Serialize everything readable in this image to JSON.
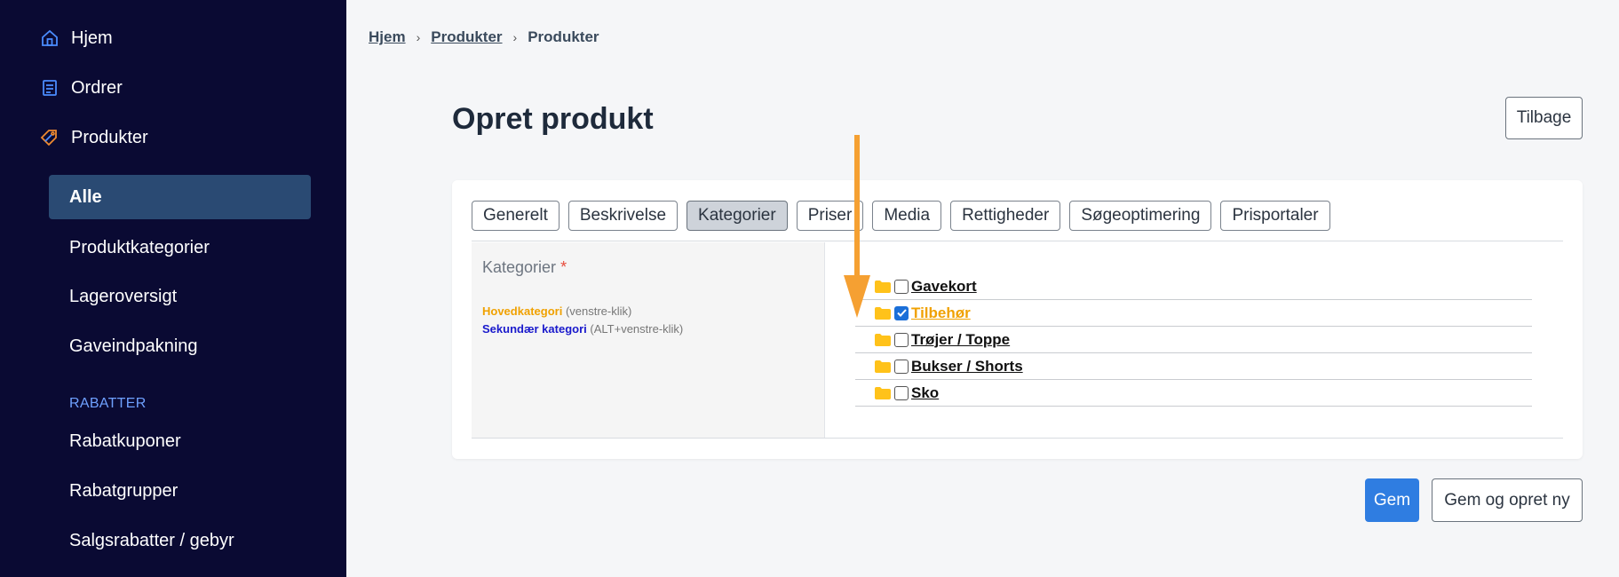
{
  "sidebar": {
    "nav": [
      {
        "label": "Hjem",
        "icon": "home-icon"
      },
      {
        "label": "Ordrer",
        "icon": "receipt-icon"
      },
      {
        "label": "Produkter",
        "icon": "tag-icon"
      }
    ],
    "sub": [
      {
        "label": "Alle",
        "active": true
      },
      {
        "label": "Produktkategorier"
      },
      {
        "label": "Lageroversigt"
      },
      {
        "label": "Gaveindpakning"
      }
    ],
    "section_title": "RABATTER",
    "section_items": [
      {
        "label": "Rabatkuponer"
      },
      {
        "label": "Rabatgrupper"
      },
      {
        "label": "Salgsrabatter / gebyr"
      }
    ]
  },
  "breadcrumb": [
    "Hjem",
    "Produkter",
    "Produkter"
  ],
  "page": {
    "title": "Opret produkt",
    "back_label": "Tilbage",
    "save_label": "Gem",
    "save_new_label": "Gem og opret ny"
  },
  "tabs": [
    {
      "label": "Generelt"
    },
    {
      "label": "Beskrivelse"
    },
    {
      "label": "Kategorier",
      "active": true
    },
    {
      "label": "Priser"
    },
    {
      "label": "Media"
    },
    {
      "label": "Rettigheder"
    },
    {
      "label": "Søgeoptimering"
    },
    {
      "label": "Prisportaler"
    }
  ],
  "categories": {
    "label": "Kategorier",
    "required_mark": "*",
    "legend_main": "Hovedkategori",
    "legend_main_hint": "(venstre-klik)",
    "legend_secondary": "Sekundær kategori",
    "legend_secondary_hint": "(ALT+venstre-klik)",
    "items": [
      {
        "label": "Gavekort",
        "checked": false
      },
      {
        "label": "Tilbehør",
        "checked": true,
        "main": true
      },
      {
        "label": "Trøjer / Toppe",
        "checked": false
      },
      {
        "label": "Bukser / Shorts",
        "checked": false
      },
      {
        "label": "Sko",
        "checked": false
      }
    ]
  },
  "colors": {
    "sidebar_bg": "#0a0a33",
    "active_bg": "#2a4a73",
    "main_category": "#f0a100",
    "secondary_category": "#1a1acc",
    "primary_button": "#2f7de1",
    "arrow": "#f5a032"
  }
}
